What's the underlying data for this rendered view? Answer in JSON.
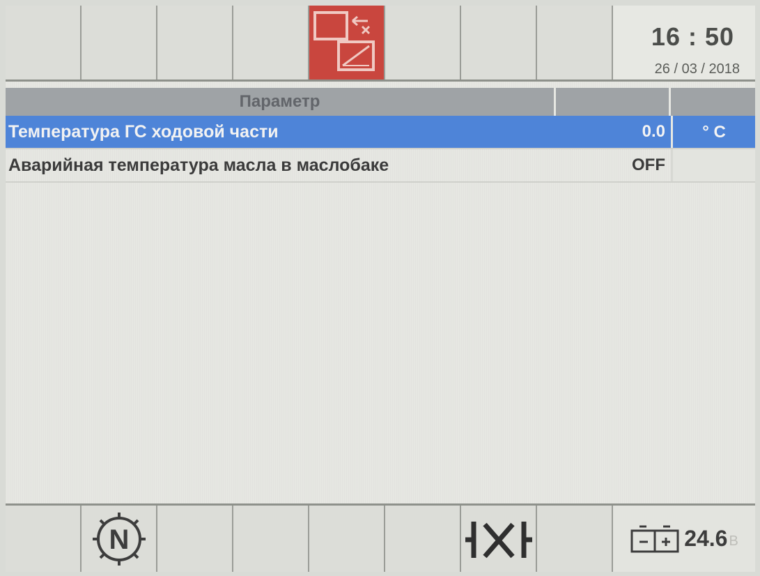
{
  "clock": {
    "time": "16 : 50",
    "date": "26 / 03 / 2018"
  },
  "topbar": {
    "active_key_icon": "screen-switch-icon"
  },
  "table": {
    "header": {
      "parameter": "Параметр"
    },
    "rows": [
      {
        "name": "Температура ГС ходовой части",
        "value": "0.0",
        "unit": "° C"
      },
      {
        "name": "Аварийная температура масла в маслобаке",
        "value": "OFF",
        "unit": ""
      }
    ]
  },
  "bottombar": {
    "neutral_icon": "neutral-gear-icon",
    "neutral_letter": "N",
    "axle_lock_icon": "axle-lock-icon",
    "battery_icon": "battery-icon",
    "battery_voltage": "24.6",
    "battery_unit": "B"
  },
  "colors": {
    "active_key": "#c9463e",
    "selected_row": "#4e84d8",
    "header_bg": "#9fa3a6"
  }
}
